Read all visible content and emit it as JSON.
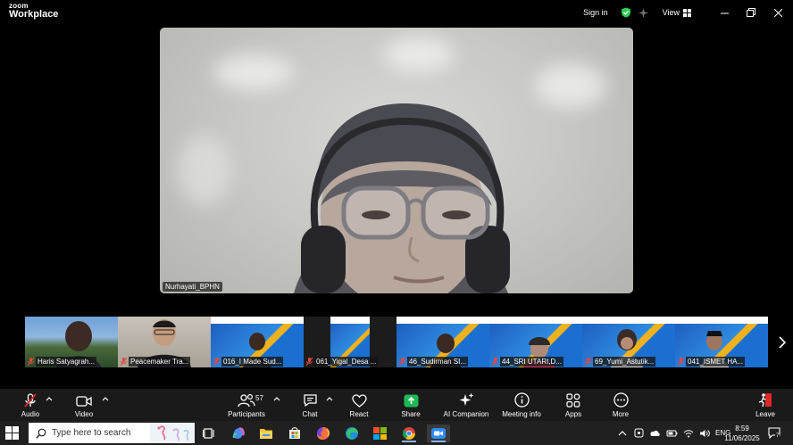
{
  "app": {
    "logo_line1": "zoom",
    "logo_line2": "Workplace",
    "sign_in": "Sign in",
    "view": "View"
  },
  "main_video": {
    "participant_name": "Nurhayati_BPHN"
  },
  "thumbnails": [
    {
      "name": "Haris Satyagrah...",
      "type": "camera",
      "muted": true
    },
    {
      "name": "Peacemaker Tra...",
      "type": "camera",
      "muted": true
    },
    {
      "name": "016_I Made Sud...",
      "type": "banner",
      "muted": true
    },
    {
      "name": "061_Yigal_Desa ...",
      "type": "banner",
      "muted": true
    },
    {
      "name": "46_Sudirman SI...",
      "type": "banner",
      "muted": true
    },
    {
      "name": "44_SRI UTARI,D...",
      "type": "banner",
      "muted": true
    },
    {
      "name": "69_Yumi_Astutik...",
      "type": "banner",
      "muted": true
    },
    {
      "name": "041_ISMET HA...",
      "type": "banner",
      "muted": true
    }
  ],
  "toolbar": {
    "audio": "Audio",
    "video": "Video",
    "participants": "Participants",
    "participants_count": "57",
    "chat": "Chat",
    "react": "React",
    "share": "Share",
    "ai_companion": "AI Companion",
    "meeting_info": "Meeting info",
    "apps": "Apps",
    "more": "More",
    "leave": "Leave"
  },
  "taskbar": {
    "search_placeholder": "Type here to search",
    "lang": "ENG",
    "time": "8:59",
    "date": "11/06/2025",
    "notification_count": "7"
  },
  "colors": {
    "accent_green": "#2ecc52",
    "share_green": "#1db954",
    "leave_red": "#e02828",
    "muted_red": "#e5483d"
  }
}
